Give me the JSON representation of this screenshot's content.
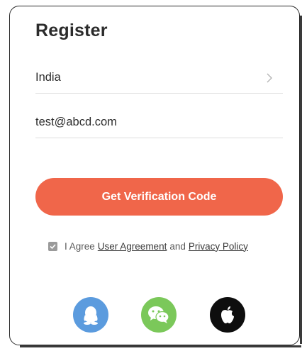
{
  "title": "Register",
  "country": {
    "value": "India"
  },
  "email": {
    "value": "test@abcd.com"
  },
  "cta_label": "Get Verification Code",
  "agreement": {
    "checked": true,
    "prefix": "I Agree",
    "user_agreement": "User Agreement",
    "and": "and",
    "privacy_policy": "Privacy Policy"
  },
  "social": [
    {
      "icon": "qq-icon",
      "color": "#5b9bde"
    },
    {
      "icon": "wechat-icon",
      "color": "#7bc85a"
    },
    {
      "icon": "apple-icon",
      "color": "#0e0e0e"
    }
  ],
  "colors": {
    "accent": "#f0664a",
    "text": "#2b2b2b",
    "divider": "#dedede"
  }
}
